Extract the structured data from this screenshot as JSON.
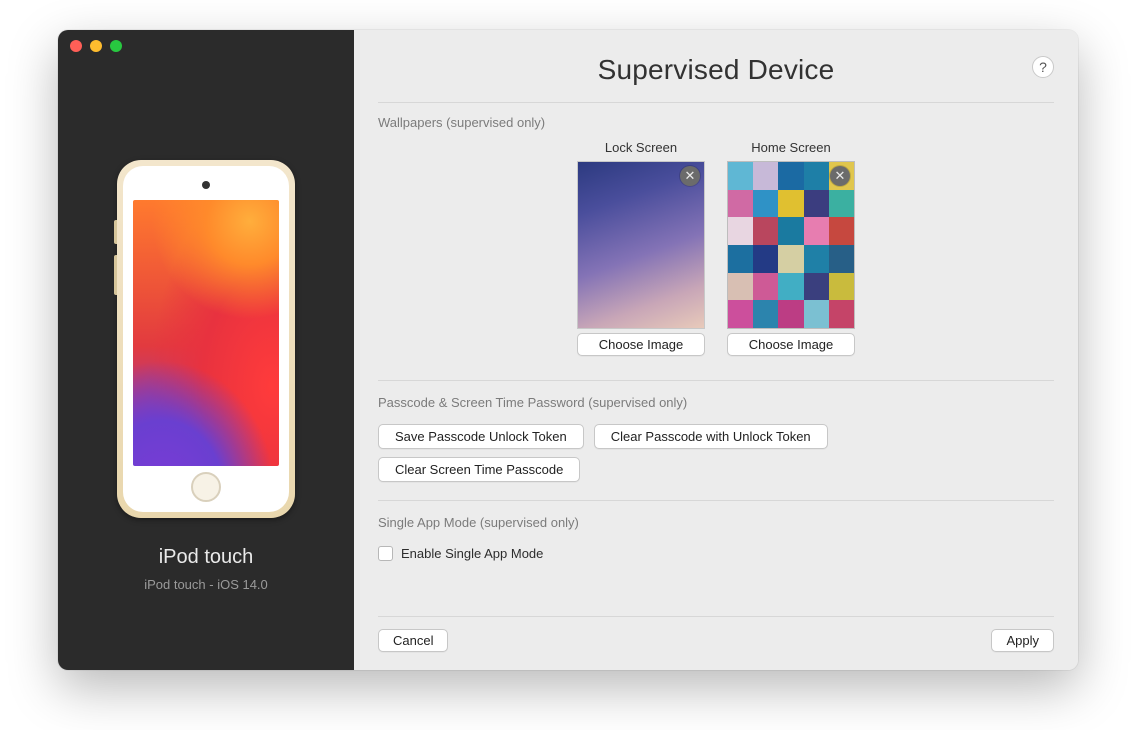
{
  "sidebar": {
    "device_name": "iPod touch",
    "device_subtitle": "iPod touch - iOS 14.0"
  },
  "header": {
    "title": "Supervised Device",
    "help_label": "?"
  },
  "wallpapers": {
    "section_label": "Wallpapers (supervised only)",
    "lock": {
      "title": "Lock Screen",
      "choose_label": "Choose Image"
    },
    "home": {
      "title": "Home Screen",
      "choose_label": "Choose Image"
    },
    "home_tile_colors": [
      "#5fb7d4",
      "#c7b9d8",
      "#1b6aa3",
      "#1e7fa7",
      "#e0c64d",
      "#d06aa4",
      "#2f92c6",
      "#e0c030",
      "#3b3d7f",
      "#3bb0a1",
      "#e8d6e1",
      "#b9465e",
      "#1a7aa0",
      "#e77db0",
      "#c6483f",
      "#1c6fa0",
      "#233a85",
      "#d5cfa3",
      "#1f80a7",
      "#275f87",
      "#d8bfb3",
      "#ce5a96",
      "#41aec4",
      "#3a3f7e",
      "#c9bb3d",
      "#cc4f9c",
      "#2c84ad",
      "#bc3d84",
      "#7bc0d2",
      "#c54468"
    ]
  },
  "passcode": {
    "section_label": "Passcode & Screen Time Password (supervised only)",
    "save_token_label": "Save Passcode Unlock Token",
    "clear_token_label": "Clear Passcode with Unlock Token",
    "clear_screentime_label": "Clear Screen Time Passcode"
  },
  "single_app": {
    "section_label": "Single App Mode (supervised only)",
    "checkbox_label": "Enable Single App Mode",
    "checked": false
  },
  "footer": {
    "cancel_label": "Cancel",
    "apply_label": "Apply"
  }
}
